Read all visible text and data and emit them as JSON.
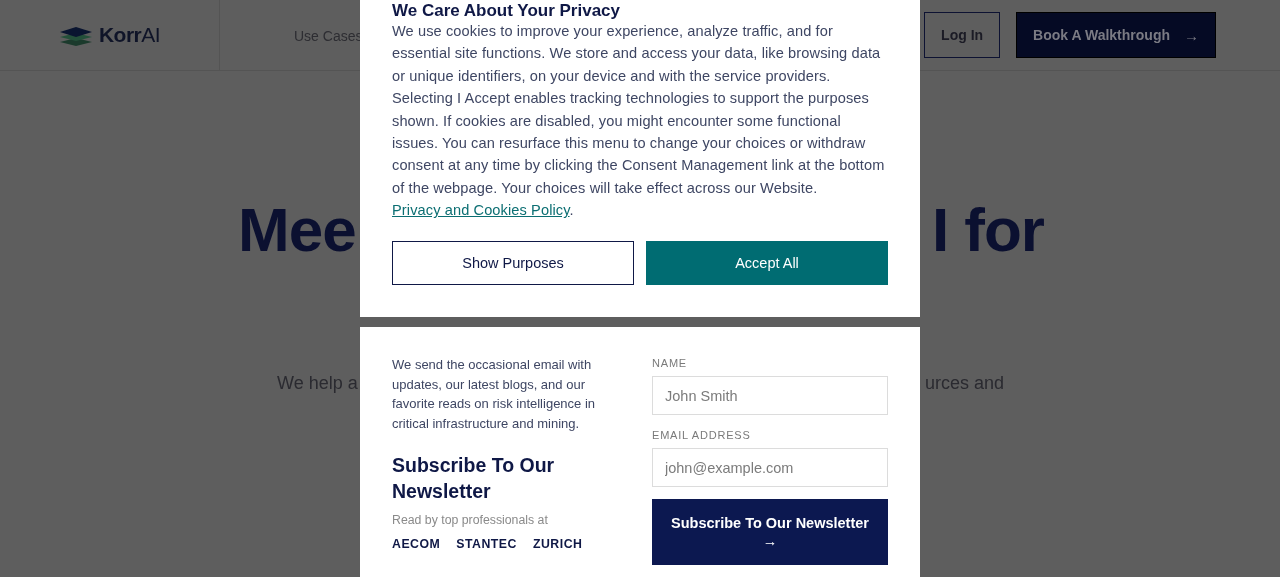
{
  "header": {
    "logo": "**Korr**AI",
    "nav": [
      {
        "label": "Use Cases"
      }
    ],
    "login": "Log In",
    "cta": {
      "label": "Book A Walkthrough",
      "arrow": "→"
    }
  },
  "hero": {
    "title_left": "Mee",
    "title_right": "I for",
    "sub_left": "We help a",
    "sub_right": "urces and"
  },
  "cookie_dialog": {
    "title": "We Care About Your Privacy",
    "body": "We use cookies to improve your experience, analyze traffic, and for essential site functions. We store and access your data, like browsing data or unique identifiers, on your device and with the service providers. Selecting I Accept enables tracking technologies to support the purposes shown. If cookies are disabled, you might encounter some functional issues. You can resurface this menu to change your choices or withdraw consent at any time by clicking the Consent Management link at the bottom of the webpage. Your choices will take effect across our Website.",
    "link": "Privacy and Cookies Policy",
    "link_after": ".",
    "buttons": [
      {
        "label": "Show Purposes",
        "kind": "outline"
      },
      {
        "label": "Accept All",
        "kind": "primary"
      }
    ]
  },
  "newsletter": {
    "intro": "We send the occasional email with updates, our latest blogs, and our favorite reads on risk intelligence in critical infrastructure and mining.",
    "heading": "Subscribe To Our Newsletter",
    "trusted": "Read by top professionals at",
    "companies": [
      "AECOM",
      "STANTEC",
      "ZURICH"
    ],
    "fields": [
      {
        "label": "NAME",
        "placeholder": "John Smith"
      },
      {
        "label": "EMAIL ADDRESS",
        "placeholder": "john@example.com"
      }
    ],
    "submit": {
      "label": "Subscribe To Our Newsletter",
      "arrow": "→"
    }
  }
}
